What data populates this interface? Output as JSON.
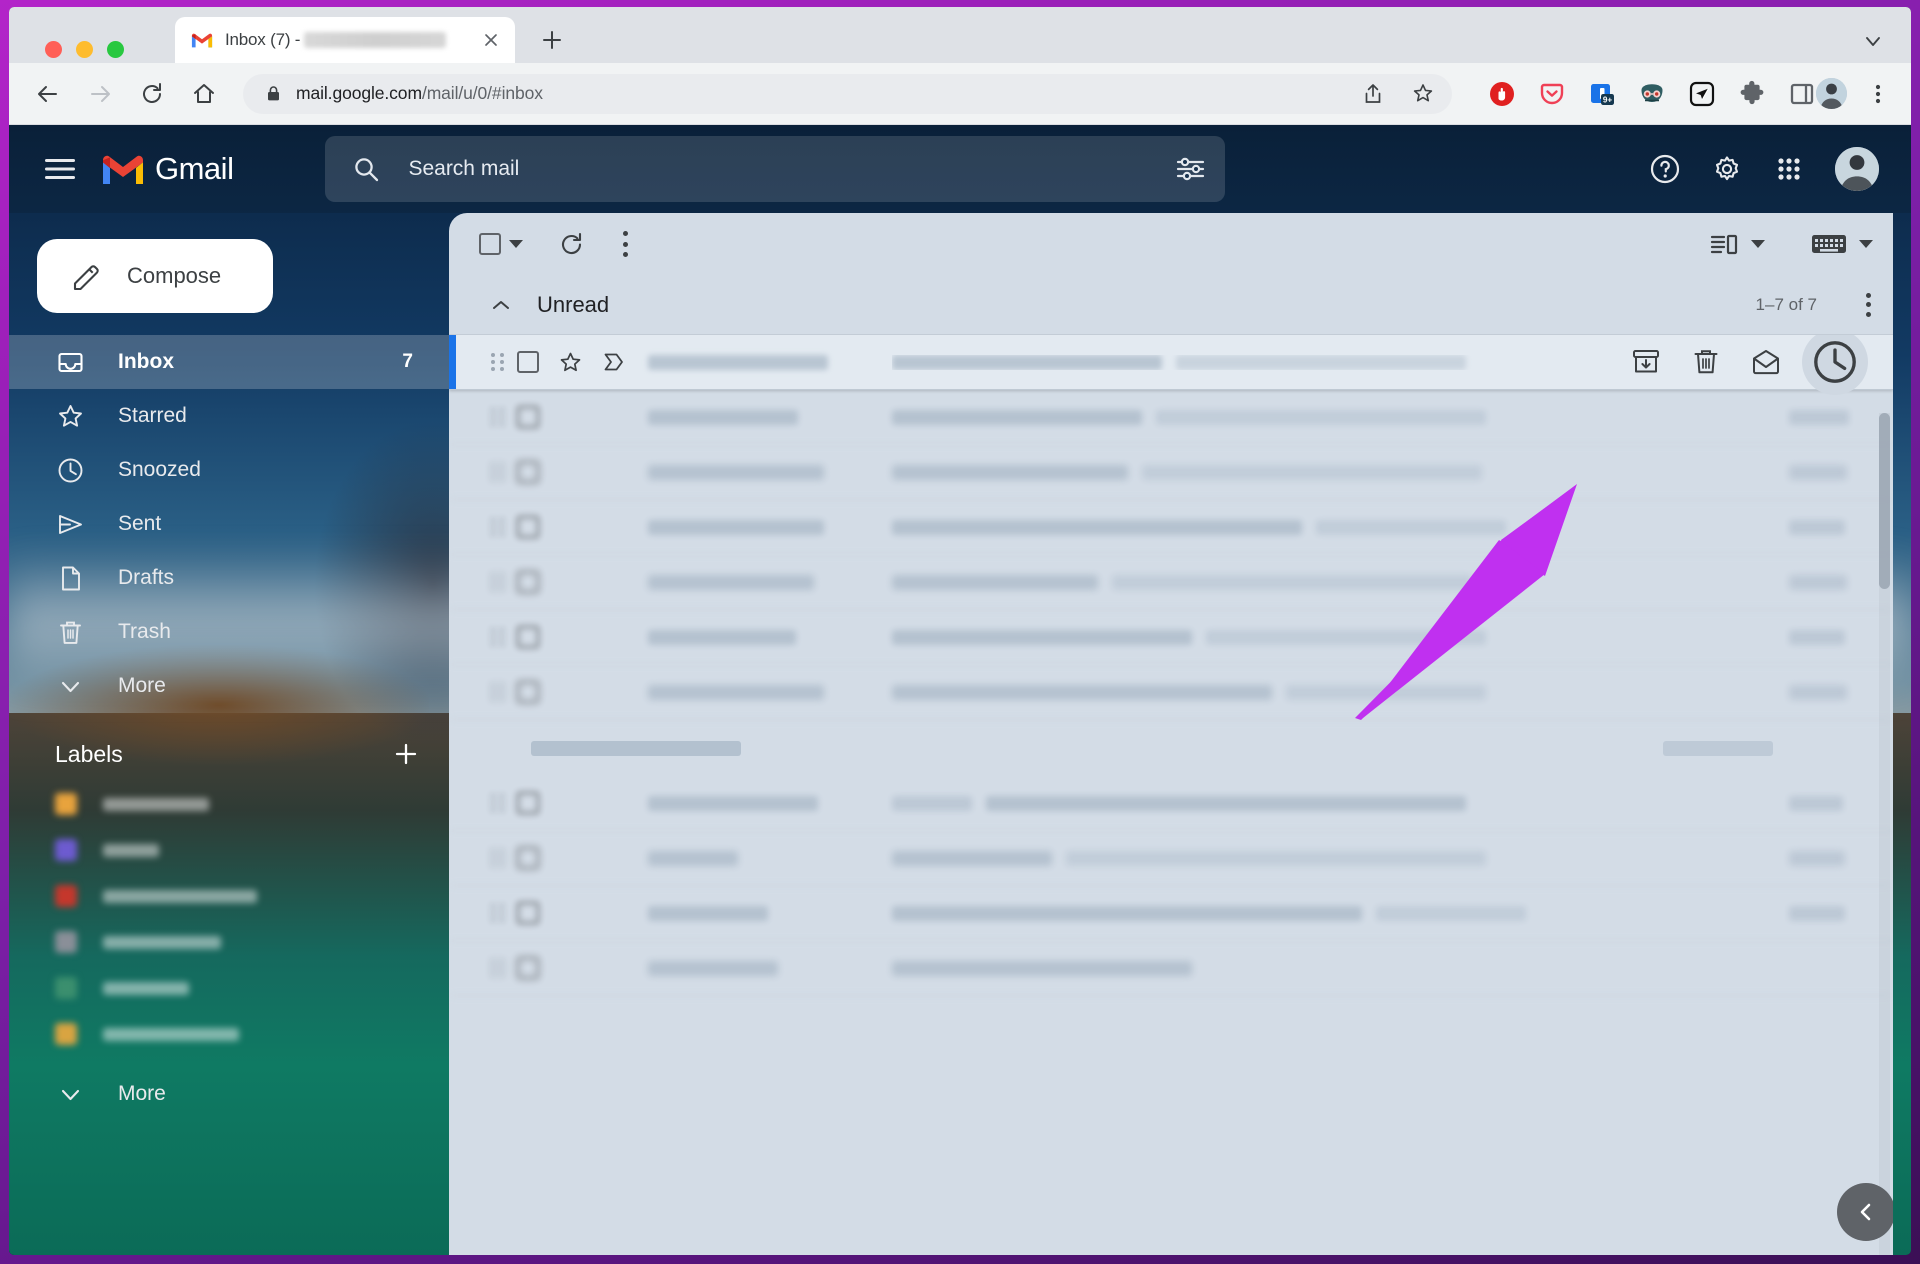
{
  "browser": {
    "tab": {
      "title": "Inbox (7) -",
      "favicon_name": "gmail-favicon",
      "redacted": true
    },
    "new_tab_label": "+",
    "url": {
      "domain": "mail.google.com",
      "path": "/mail/u/0/#inbox",
      "full": "mail.google.com/mail/u/0/#inbox"
    },
    "nav": {
      "back": "back-arrow",
      "forward": "forward-arrow",
      "reload": "reload",
      "home": "home"
    },
    "omni_actions": [
      "share-icon",
      "bookmark-star-icon"
    ],
    "extensions": [
      {
        "name": "adblock-icon",
        "color": "#e02020"
      },
      {
        "name": "pocket-icon",
        "color": "#ef4056"
      },
      {
        "name": "notifications-icon",
        "color": "#1a73e8",
        "badge": "9+"
      },
      {
        "name": "mask-icon",
        "color": "#2f5d62"
      },
      {
        "name": "send-later-icon",
        "color": "#111111"
      },
      {
        "name": "puzzle-extensions-icon",
        "color": "#5f6368"
      },
      {
        "name": "side-panel-icon",
        "color": "#5f6368"
      }
    ],
    "profile_avatar": "chrome-profile-avatar",
    "menu": "chrome-three-dot-menu"
  },
  "gmail": {
    "brand": "Gmail",
    "menu_icon": "hamburger-menu-icon",
    "search": {
      "placeholder": "Search mail",
      "value": "",
      "icon": "search-icon",
      "options_icon": "search-options-icon"
    },
    "header_actions": [
      "help-icon",
      "settings-gear-icon",
      "google-apps-grid-icon"
    ],
    "account_avatar": "google-account-avatar",
    "compose": {
      "label": "Compose",
      "icon": "pencil-icon"
    },
    "sidebar": {
      "items": [
        {
          "label": "Inbox",
          "icon": "inbox-icon",
          "count": "7",
          "active": true
        },
        {
          "label": "Starred",
          "icon": "star-icon",
          "count": "",
          "active": false
        },
        {
          "label": "Snoozed",
          "icon": "clock-icon",
          "count": "",
          "active": false
        },
        {
          "label": "Sent",
          "icon": "send-icon",
          "count": "",
          "active": false
        },
        {
          "label": "Drafts",
          "icon": "draft-icon",
          "count": "",
          "active": false
        },
        {
          "label": "Trash",
          "icon": "trash-icon",
          "count": "",
          "active": false
        },
        {
          "label": "More",
          "icon": "chevron-down-icon",
          "count": "",
          "active": false
        }
      ],
      "labels_header": "Labels",
      "labels_add_icon": "plus-icon",
      "labels": [
        {
          "color": "#e8a33d"
        },
        {
          "color": "#6d5bd0"
        },
        {
          "color": "#c5372c"
        },
        {
          "color": "#8a8f98"
        },
        {
          "color": "#3b8f6e"
        },
        {
          "color": "#d9a441"
        }
      ],
      "more_bottom": "More"
    },
    "toolbar": {
      "select_all": "select-all-checkbox",
      "select_dropdown": "select-dropdown-caret",
      "refresh": "refresh-icon",
      "more": "more-options-icon",
      "display_density": "display-density-icon",
      "input_tools": "keyboard-input-tools-icon"
    },
    "section": {
      "title": "Unread",
      "collapse_icon": "collapse-chevron-up-icon",
      "pagination": "1–7 of 7",
      "more": "section-more-options-icon"
    },
    "hovered_row": {
      "grip": "drag-grip-icon",
      "checkbox": "row-checkbox",
      "star": "star-icon",
      "important": "importance-marker-icon",
      "actions": [
        {
          "name": "archive-icon",
          "highlighted": false
        },
        {
          "name": "delete-icon",
          "highlighted": false
        },
        {
          "name": "mark-read-icon",
          "highlighted": false
        },
        {
          "name": "snooze-clock-icon",
          "highlighted": true
        }
      ]
    },
    "side_toggle": "collapse-panel-chevron-left-icon"
  },
  "annotation": {
    "arrow_color": "#c030f0",
    "points_to": "snooze-clock-icon"
  },
  "theme": {
    "frame": "#9a1fb8",
    "gmail_dark": "#0b2a4a",
    "panel": "#d3dce6",
    "accent": "#1a73e8"
  }
}
